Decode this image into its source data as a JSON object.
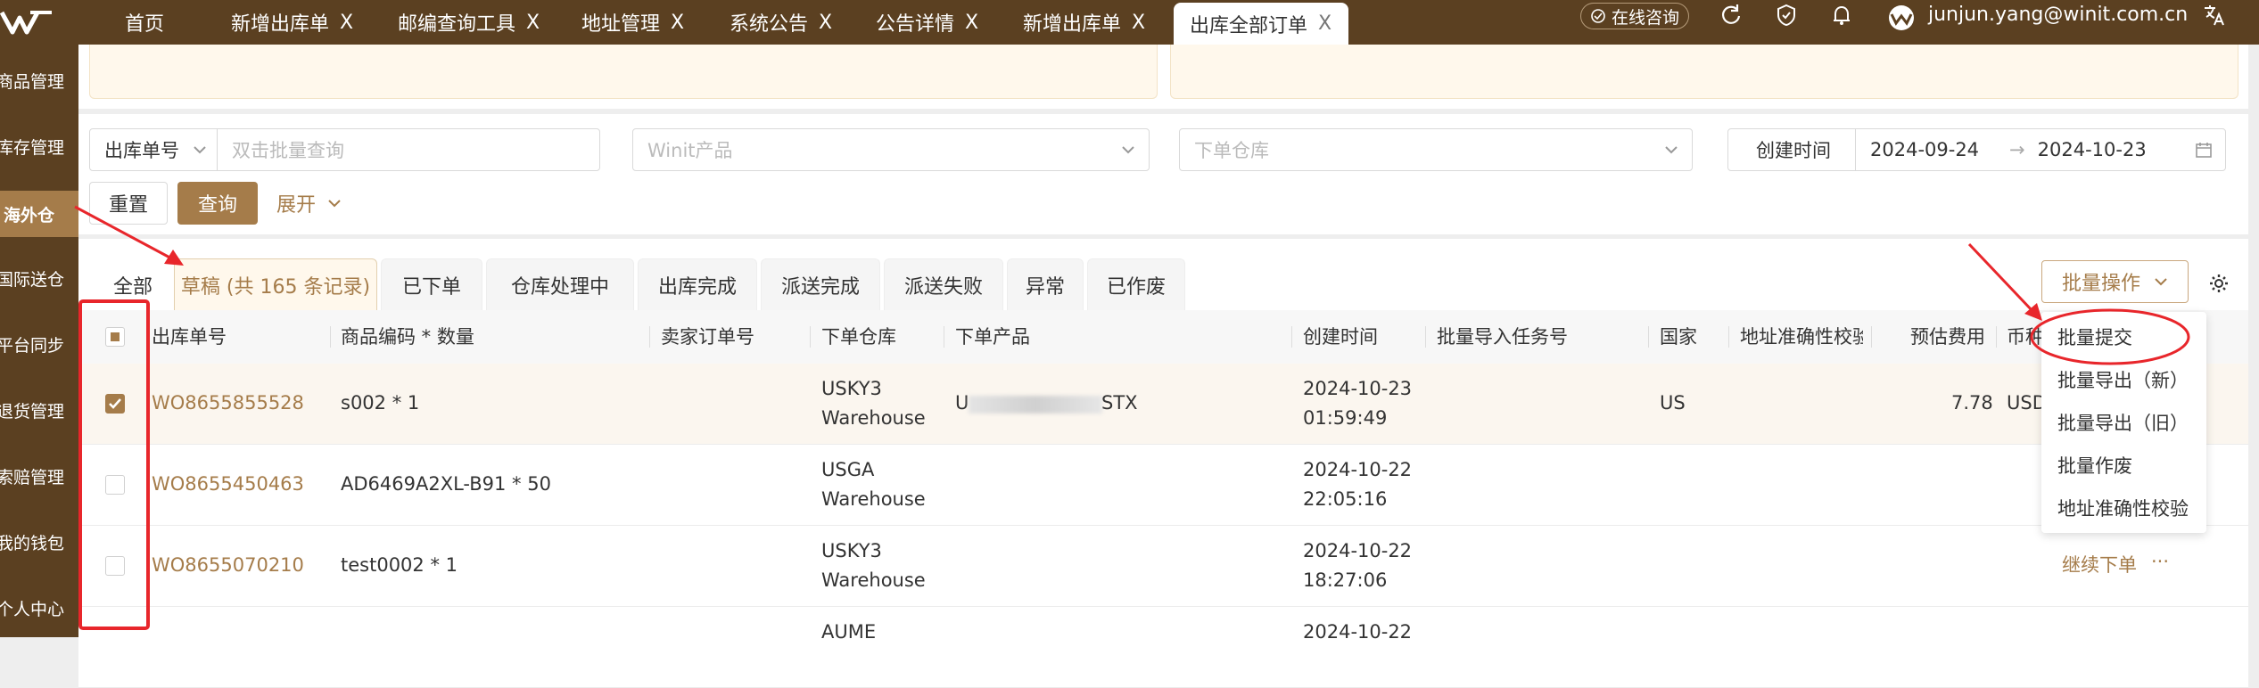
{
  "topbar": {
    "tabs": [
      {
        "label": "首页",
        "closable": false
      },
      {
        "label": "新增出库单",
        "closable": true
      },
      {
        "label": "邮编查询工具",
        "closable": true
      },
      {
        "label": "地址管理",
        "closable": true
      },
      {
        "label": "系统公告",
        "closable": true
      },
      {
        "label": "公告详情",
        "closable": true
      },
      {
        "label": "新增出库单",
        "closable": true
      },
      {
        "label": "出库全部订单",
        "closable": true,
        "active": true
      }
    ],
    "close_glyph": "X",
    "online_consult": "在线咨询",
    "user_email": "junjun.yang@winit.com.cn",
    "icons": [
      "refresh-icon",
      "shield-icon",
      "bell-icon",
      "translate-icon"
    ]
  },
  "sidebar": {
    "items": [
      {
        "label": "商品管理"
      },
      {
        "label": "库存管理"
      },
      {
        "label": "海外仓",
        "active": true
      },
      {
        "label": "国际送仓"
      },
      {
        "label": "平台同步"
      },
      {
        "label": "退货管理"
      },
      {
        "label": "索赔管理"
      },
      {
        "label": "我的钱包"
      },
      {
        "label": "个人中心"
      }
    ]
  },
  "filters": {
    "order_type_select": "出库单号",
    "batch_query_placeholder": "双击批量查询",
    "product_placeholder": "Winit产品",
    "warehouse_placeholder": "下单仓库",
    "date_label": "创建时间",
    "date_start": "2024-09-24",
    "date_end": "2024-10-23",
    "date_arrow": "→",
    "reset_label": "重置",
    "query_label": "查询",
    "expand_label": "展开"
  },
  "status_tabs": [
    {
      "label": "全部"
    },
    {
      "label": "草稿 (共 165 条记录)",
      "active": true
    },
    {
      "label": "已下单"
    },
    {
      "label": "仓库处理中"
    },
    {
      "label": "出库完成"
    },
    {
      "label": "派送完成"
    },
    {
      "label": "派送失败"
    },
    {
      "label": "异常"
    },
    {
      "label": "已作废"
    }
  ],
  "batch": {
    "button_label": "批量操作",
    "menu_items": [
      "批量提交",
      "批量导出（新）",
      "批量导出（旧）",
      "批量作废",
      "地址准确性校验"
    ]
  },
  "table": {
    "headers": [
      "出库单号",
      "商品编码 * 数量",
      "卖家订单号",
      "下单仓库",
      "下单产品",
      "创建时间",
      "批量导入任务号",
      "国家",
      "地址准确性校验",
      "预估费用",
      "币种"
    ],
    "rows": [
      {
        "checked": true,
        "order_no": "WO8655855528",
        "sku_qty": "s002 * 1",
        "warehouse": [
          "USKY3",
          "Warehouse"
        ],
        "product_prefix": "U",
        "product_suffix": "STX",
        "created": [
          "2024-10-23",
          "01:59:49"
        ],
        "country": "US",
        "fee": "7.78",
        "currency": "USD"
      },
      {
        "checked": false,
        "order_no": "WO8655450463",
        "sku_qty": "AD6469A2XL-B91 * 50",
        "warehouse": [
          "USGA",
          "Warehouse"
        ],
        "product_prefix": "",
        "product_suffix": "",
        "created": [
          "2024-10-22",
          "22:05:16"
        ],
        "country": "",
        "fee": "",
        "currency": ""
      },
      {
        "checked": false,
        "order_no": "WO8655070210",
        "sku_qty": "test0002 * 1",
        "warehouse": [
          "USKY3",
          "Warehouse"
        ],
        "product_prefix": "",
        "product_suffix": "",
        "created": [
          "2024-10-22",
          "18:27:06"
        ],
        "country": "",
        "fee": "",
        "currency": ""
      },
      {
        "checked": false,
        "order_no": "",
        "sku_qty": "",
        "warehouse": [
          "AUME",
          ""
        ],
        "product_prefix": "",
        "product_suffix": "",
        "created": [
          "2024-10-22",
          ""
        ],
        "country": "",
        "fee": "",
        "currency": ""
      }
    ],
    "row_action": "继续下单",
    "row_more": "···"
  },
  "colors": {
    "brand_dark": "#5b4021",
    "brand_accent": "#a57c4a",
    "annotation_red": "#e8262b"
  }
}
